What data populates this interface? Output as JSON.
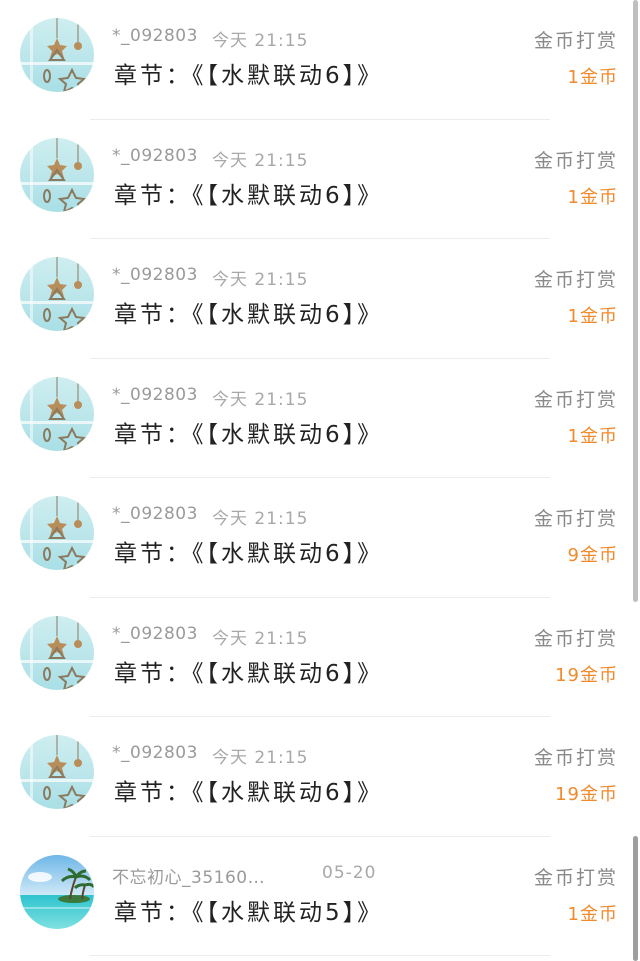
{
  "reward_list": [
    {
      "user": "*_092803",
      "time": "今天 21:15",
      "chapter": "章节：《【水默联动6】》",
      "type_label": "金币打赏",
      "amount": "1金币",
      "avatar_icon": "star-ornament-icon"
    },
    {
      "user": "*_092803",
      "time": "今天 21:15",
      "chapter": "章节：《【水默联动6】》",
      "type_label": "金币打赏",
      "amount": "1金币",
      "avatar_icon": "star-ornament-icon"
    },
    {
      "user": "*_092803",
      "time": "今天 21:15",
      "chapter": "章节：《【水默联动6】》",
      "type_label": "金币打赏",
      "amount": "1金币",
      "avatar_icon": "star-ornament-icon"
    },
    {
      "user": "*_092803",
      "time": "今天 21:15",
      "chapter": "章节：《【水默联动6】》",
      "type_label": "金币打赏",
      "amount": "1金币",
      "avatar_icon": "star-ornament-icon"
    },
    {
      "user": "*_092803",
      "time": "今天 21:15",
      "chapter": "章节：《【水默联动6】》",
      "type_label": "金币打赏",
      "amount": "9金币",
      "avatar_icon": "star-ornament-icon"
    },
    {
      "user": "*_092803",
      "time": "今天 21:15",
      "chapter": "章节：《【水默联动6】》",
      "type_label": "金币打赏",
      "amount": "19金币",
      "avatar_icon": "star-ornament-icon"
    },
    {
      "user": "*_092803",
      "time": "今天 21:15",
      "chapter": "章节：《【水默联动6】》",
      "type_label": "金币打赏",
      "amount": "19金币",
      "avatar_icon": "star-ornament-icon"
    },
    {
      "user": "不忘初心_35160…",
      "time": "05-20",
      "chapter": "章节：《【水默联动5】》",
      "type_label": "金币打赏",
      "amount": "1金币",
      "avatar_icon": "beach-island-icon"
    }
  ],
  "colors": {
    "amount": "#f08a2c",
    "username": "#9a9a9a",
    "chapter": "#222222",
    "type_label": "#8a8a8a"
  }
}
